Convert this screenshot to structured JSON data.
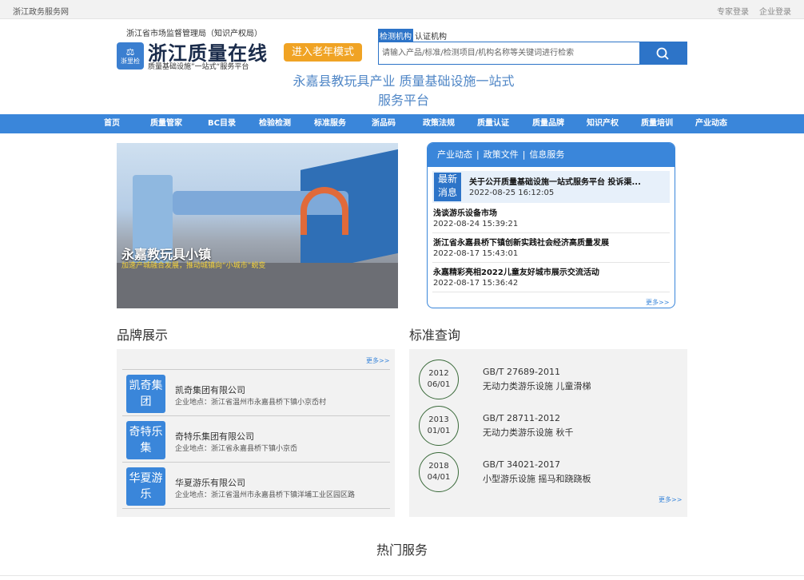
{
  "topbar": {
    "site": "浙江政务服务网",
    "expert_login": "专家登录",
    "company_login": "企业登录"
  },
  "header": {
    "org_name": "浙江省市场监督管理局（知识产权局）",
    "logo_emblem_text": "浙里检",
    "logo_title": "浙江质量在线",
    "logo_subtitle": "质量基础设施”一站式“服务平台",
    "elder_mode": "进入老年模式",
    "platform_title": "永嘉县教玩具产业 质量基础设施一站式服务平台"
  },
  "search": {
    "tabs": [
      "检测机构",
      "认证机构"
    ],
    "active_tab": 0,
    "placeholder": "请输入产品/标准/检测项目/机构名称等关键词进行检索"
  },
  "nav": [
    "首页",
    "质量管家",
    "BC目录",
    "检验检测",
    "标准服务",
    "浙品码",
    "政策法规",
    "质量认证",
    "质量品牌",
    "知识产权",
    "质量培训",
    "产业动态"
  ],
  "banner": {
    "title": "永嘉教玩具小镇",
    "subtitle": "加速产城融合发展，推动城镇向“小城市”蜕变"
  },
  "news": {
    "tabs": [
      "产业动态",
      "政策文件",
      "信息服务"
    ],
    "featured_badge": "最新消息",
    "featured_title": "关于公开质量基础设施一站式服务平台 投诉渠...",
    "featured_date": "2022-08-25 16:12:05",
    "items": [
      {
        "title": "浅谈游乐设备市场",
        "date": "2022-08-24 15:39:21"
      },
      {
        "title": "浙江省永嘉县桥下镇创新实践社会经济高质量发展",
        "date": "2022-08-17 15:43:01"
      },
      {
        "title": "永嘉精彩亮相2022儿童友好城市展示交流活动",
        "date": "2022-08-17 15:36:42"
      }
    ],
    "more": "更多>>"
  },
  "brand": {
    "title": "品牌展示",
    "more": "更多>>",
    "items": [
      {
        "badge": "凯奇集团",
        "name": "凯奇集团有限公司",
        "address": "企业地点：浙江省温州市永嘉县桥下镇小京岙村"
      },
      {
        "badge": "奇特乐集",
        "name": "奇特乐集团有限公司",
        "address": "企业地点：浙江省永嘉县桥下镇小京岙"
      },
      {
        "badge": "华夏游乐",
        "name": "华夏游乐有限公司",
        "address": "企业地点：浙江省温州市永嘉县桥下镇洋埔工业区园区路"
      }
    ]
  },
  "standards": {
    "title": "标准查询",
    "more": "更多>>",
    "items": [
      {
        "year": "2012",
        "md": "06/01",
        "code": "GB/T 27689-2011",
        "name": "无动力类游乐设施 儿童滑梯"
      },
      {
        "year": "2013",
        "md": "01/01",
        "code": "GB/T 28711-2012",
        "name": "无动力类游乐设施 秋千"
      },
      {
        "year": "2018",
        "md": "04/01",
        "code": "GB/T 34021-2017",
        "name": "小型游乐设施 摇马和跷跷板"
      }
    ]
  },
  "hot_services": {
    "title": "热门服务"
  },
  "colors": {
    "primary": "#3a86da",
    "accent": "#f0a324",
    "panel_bg": "#f2f2f2"
  }
}
